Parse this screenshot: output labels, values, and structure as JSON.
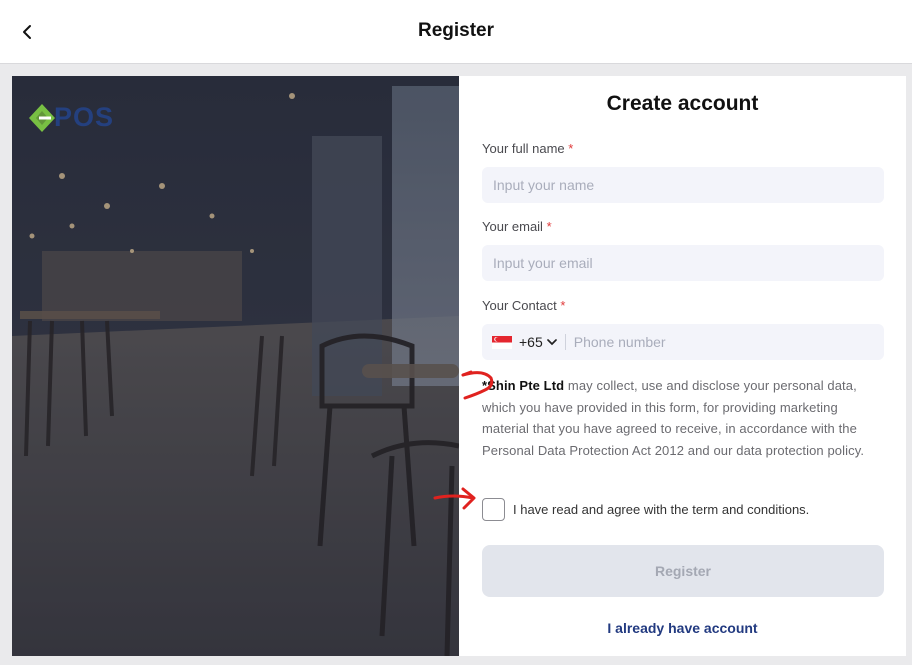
{
  "header": {
    "title": "Register",
    "back_icon": "chevron-left-icon"
  },
  "brand": {
    "logo_text": "POS",
    "logo_colors": {
      "mark": "#78c043",
      "text": "#24407f"
    }
  },
  "form": {
    "title": "Create account",
    "fullname": {
      "label": "Your full name",
      "required_mark": "*",
      "placeholder": "Input your name",
      "value": ""
    },
    "email": {
      "label": "Your email",
      "required_mark": "*",
      "placeholder": "Input your email",
      "value": ""
    },
    "contact": {
      "label": "Your Contact",
      "required_mark": "*",
      "country_flag": "singapore-flag-icon",
      "country_code": "+65",
      "placeholder": "Phone number",
      "value": ""
    },
    "consent": {
      "company": "*Shin Pte Ltd",
      "text": " may collect, use and disclose your personal data, which you have provided in this form, for providing marketing material that you have agreed to receive, in accordance with the Personal Data Protection Act 2012 and our data protection policy."
    },
    "terms": {
      "label": "I have read and agree with the term and conditions.",
      "checked": false
    },
    "register_label": "Register",
    "login_label": "I already have account"
  },
  "colors": {
    "accent": "#223a80",
    "required": "#e03a3a",
    "annotation": "#e0221f",
    "button_disabled": "#e2e5ec"
  }
}
